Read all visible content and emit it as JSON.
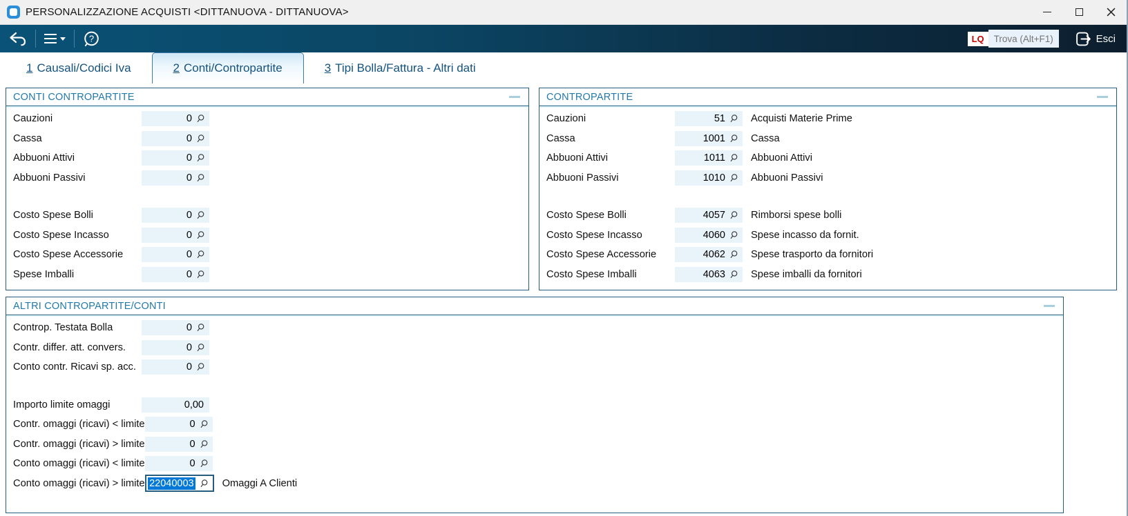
{
  "window": {
    "title": "PERSONALIZZAZIONE ACQUISTI <DITTANUOVA - DITTANUOVA>"
  },
  "icons": {
    "app_logo": "blue-rounded-square",
    "back": "undo-arrow",
    "menu": "hamburger-with-caret",
    "help_glyph": "?",
    "exit": "arrow-leaving-box",
    "lens": "magnifier",
    "collapse": "dash",
    "window_controls": [
      "minimize",
      "maximize",
      "close"
    ]
  },
  "toolbar": {
    "lq_badge": "LQ",
    "search_placeholder": "Trova (Alt+F1)",
    "exit_label": "Esci"
  },
  "tabs": [
    {
      "number": "1",
      "label": "Causali/Codici Iva",
      "active": false
    },
    {
      "number": "2",
      "label": "Conti/Contropartite",
      "active": true
    },
    {
      "number": "3",
      "label": "Tipi Bolla/Fattura - Altri dati",
      "active": false
    }
  ],
  "panels": {
    "conti_contropartite": {
      "title": "CONTI CONTROPARTITE",
      "sections": [
        [
          {
            "label": "Cauzioni",
            "value": "0",
            "lens": true
          },
          {
            "label": "Cassa",
            "value": "0",
            "lens": true
          },
          {
            "label": "Abbuoni Attivi",
            "value": "0",
            "lens": true
          },
          {
            "label": "Abbuoni Passivi",
            "value": "0",
            "lens": true
          }
        ],
        [
          {
            "label": "Costo Spese Bolli",
            "value": "0",
            "lens": true
          },
          {
            "label": "Costo Spese Incasso",
            "value": "0",
            "lens": true
          },
          {
            "label": "Costo Spese Accessorie",
            "value": "0",
            "lens": true
          },
          {
            "label": "Spese Imballi",
            "value": "0",
            "lens": true
          }
        ]
      ]
    },
    "contropartite": {
      "title": "CONTROPARTITE",
      "sections": [
        [
          {
            "label": "Cauzioni",
            "value": "51",
            "lens": true,
            "desc": "Acquisti Materie Prime"
          },
          {
            "label": "Cassa",
            "value": "1001",
            "lens": true,
            "desc": "Cassa"
          },
          {
            "label": "Abbuoni Attivi",
            "value": "1011",
            "lens": true,
            "desc": "Abbuoni Attivi"
          },
          {
            "label": "Abbuoni Passivi",
            "value": "1010",
            "lens": true,
            "desc": "Abbuoni Passivi"
          }
        ],
        [
          {
            "label": "Costo Spese Bolli",
            "value": "4057",
            "lens": true,
            "desc": "Rimborsi spese bolli"
          },
          {
            "label": "Costo Spese Incasso",
            "value": "4060",
            "lens": true,
            "desc": "Spese incasso da fornit."
          },
          {
            "label": "Costo Spese Accessorie",
            "value": "4062",
            "lens": true,
            "desc": "Spese trasporto da fornitori"
          },
          {
            "label": "Costo Spese Imballi",
            "value": "4063",
            "lens": true,
            "desc": "Spese imballi da fornitori"
          }
        ]
      ]
    },
    "altri": {
      "title": "ALTRI CONTROPARTITE/CONTI",
      "sections": [
        [
          {
            "label": "Controp. Testata Bolla",
            "value": "0",
            "lens": true
          },
          {
            "label": "Contr. differ. att. convers.",
            "value": "0",
            "lens": true
          },
          {
            "label": "Conto contr. Ricavi sp. acc.",
            "value": "0",
            "lens": true
          }
        ],
        [
          {
            "label": "Importo limite omaggi",
            "value": "0,00",
            "lens": false
          },
          {
            "label": "Contr. omaggi (ricavi) < limite",
            "value": "0",
            "lens": true
          },
          {
            "label": "Contr. omaggi (ricavi) > limite",
            "value": "0",
            "lens": true
          },
          {
            "label": "Conto omaggi (ricavi) < limite",
            "value": "0",
            "lens": true
          },
          {
            "label": "Conto omaggi (ricavi) > limite",
            "value": "22040003",
            "lens": true,
            "focused": true,
            "selected": true,
            "desc": "Omaggi A Clienti"
          }
        ]
      ]
    }
  }
}
